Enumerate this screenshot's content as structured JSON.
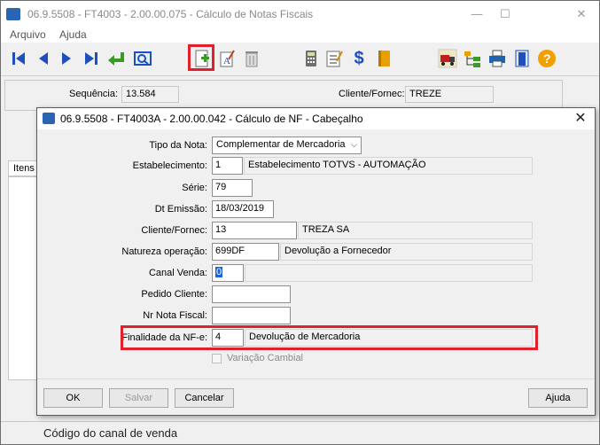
{
  "main": {
    "title": "06.9.5508 - FT4003 - 2.00.00.075 - Cálculo de Notas Fiscais",
    "menu": [
      "Arquivo",
      "Ajuda"
    ],
    "header": {
      "sequencia_label": "Sequência:",
      "sequencia_value": "13.584",
      "cliente_label": "Cliente/Fornec:",
      "cliente_value": "TREZE"
    },
    "tab_label": "Itens",
    "status_text": "Código do canal de venda"
  },
  "toolbar_icons": [
    "first-record-icon",
    "previous-record-icon",
    "next-record-icon",
    "last-record-icon",
    "return-icon",
    "search-preview-icon",
    "new-document-icon",
    "edit-text-icon",
    "trash-icon",
    "calculator-icon",
    "checklist-icon",
    "dollar-icon",
    "book-icon",
    "truck-icon",
    "tree-icon",
    "printer-icon",
    "exit-door-icon",
    "help-icon"
  ],
  "colors": {
    "highlight": "#e0202a",
    "toolbar_blue": "#1e4fbf",
    "green": "#3a9a24"
  },
  "dialog": {
    "title": "06.9.5508 - FT4003A - 2.00.00.042 - Cálculo de NF - Cabeçalho",
    "fields": {
      "tipo_label": "Tipo da Nota:",
      "tipo_value": "Complementar de Mercadoria",
      "estab_label": "Estabelecimento:",
      "estab_code": "1",
      "estab_desc": "Estabelecimento TOTVS - AUTOMAÇÃO",
      "serie_label": "Série:",
      "serie_value": "79",
      "dt_label": "Dt Emissão:",
      "dt_value": "18/03/2019",
      "cliente_label": "Cliente/Fornec:",
      "cliente_code": "13",
      "cliente_desc": "TREZA SA",
      "natureza_label": "Natureza operação:",
      "natureza_code": "699DF",
      "natureza_desc": "Devolução a Fornecedor",
      "canal_label": "Canal Venda:",
      "canal_value": "0",
      "pedido_label": "Pedido Cliente:",
      "pedido_value": "",
      "nrnota_label": "Nr Nota Fiscal:",
      "nrnota_value": "",
      "finalidade_label": "Finalidade da NF-e:",
      "finalidade_code": "4",
      "finalidade_desc": "Devolução de Mercadoria",
      "variacao_label": "Variação Cambial"
    },
    "buttons": {
      "ok": "OK",
      "salvar": "Salvar",
      "cancelar": "Cancelar",
      "ajuda": "Ajuda"
    }
  }
}
